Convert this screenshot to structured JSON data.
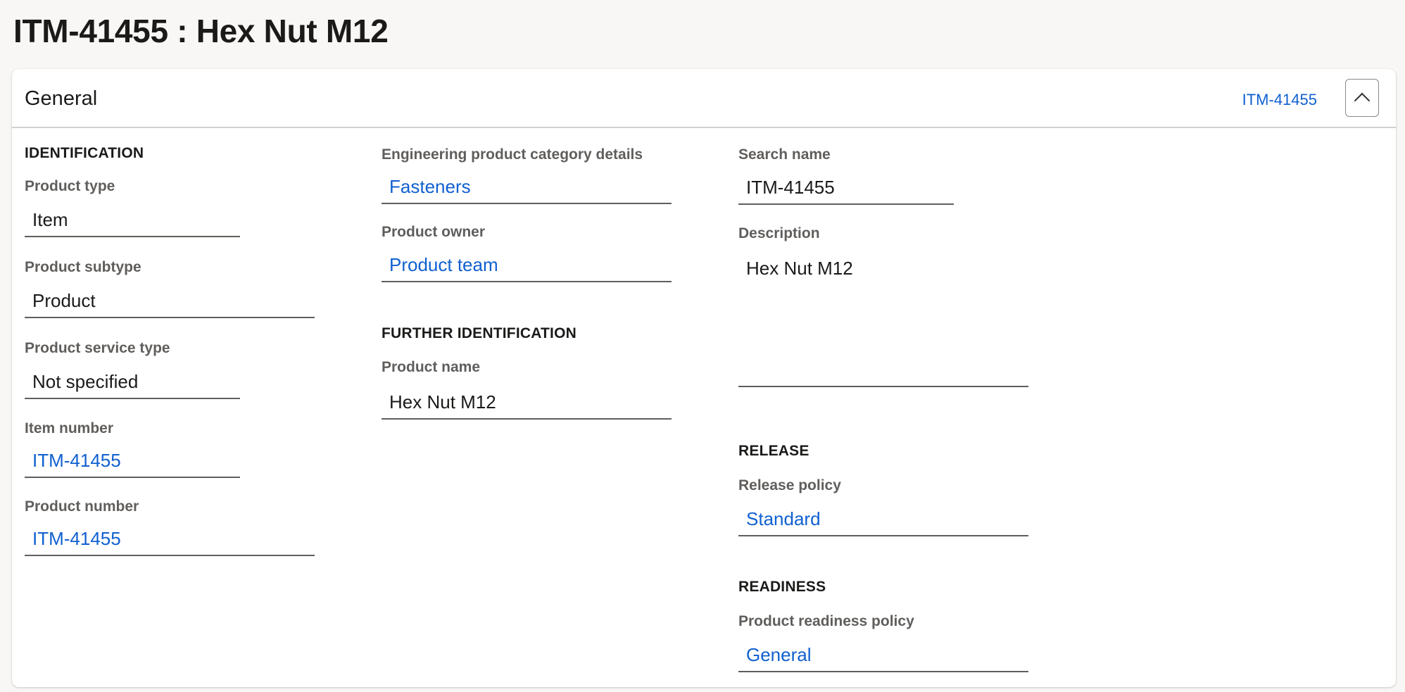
{
  "page": {
    "title": "ITM-41455 : Hex Nut M12"
  },
  "general": {
    "title": "General",
    "summary": "ITM-41455",
    "identification": {
      "heading": "IDENTIFICATION",
      "product_type": {
        "label": "Product type",
        "value": "Item"
      },
      "product_subtype": {
        "label": "Product subtype",
        "value": "Product"
      },
      "product_service_type": {
        "label": "Product service type",
        "value": "Not specified"
      },
      "item_number": {
        "label": "Item number",
        "value": "ITM-41455"
      },
      "product_number": {
        "label": "Product number",
        "value": "ITM-41455"
      }
    },
    "engineering": {
      "category_details": {
        "label": "Engineering product category details",
        "value": "Fasteners"
      },
      "product_owner": {
        "label": "Product owner",
        "value": "Product team"
      }
    },
    "further_identification": {
      "heading": "FURTHER IDENTIFICATION",
      "product_name": {
        "label": "Product name",
        "value": "Hex Nut M12"
      }
    },
    "names": {
      "search_name": {
        "label": "Search name",
        "value": "ITM-41455"
      },
      "description": {
        "label": "Description",
        "value": "Hex Nut M12"
      }
    },
    "release": {
      "heading": "RELEASE",
      "release_policy": {
        "label": "Release policy",
        "value": "Standard"
      }
    },
    "readiness": {
      "heading": "READINESS",
      "product_readiness_policy": {
        "label": "Product readiness policy",
        "value": "General"
      }
    }
  },
  "colors": {
    "link": "#1060d0",
    "label": "#605e5c",
    "text": "#1b1a19",
    "background": "#f8f7f6"
  }
}
